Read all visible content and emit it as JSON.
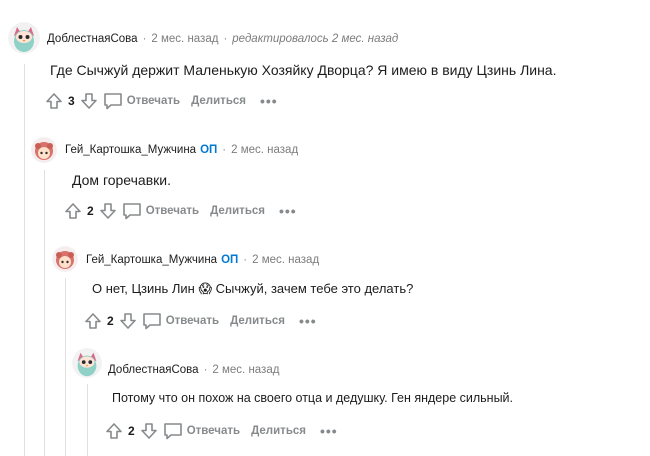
{
  "colors": {
    "accent_op": "#0079d3",
    "muted": "#878a8c",
    "thread_line": "#e0e0e0"
  },
  "comments": [
    {
      "author": "ДоблестнаяСова",
      "time": "2 мес. назад",
      "edited": "редактировалось 2 мес. назад",
      "text": "Где Сычжуй держит Маленькую Хозяйку Дворца? Я имею в виду Цзинь Лина.",
      "score": "3",
      "reply_label": "Отвечать",
      "share_label": "Делиться",
      "avatar_icon": "owl-avatar-icon"
    },
    {
      "author": "Гей_Картошка_Мужчина",
      "op_badge": "ОП",
      "time": "2 мес. назад",
      "text": "Дом горечавки.",
      "score": "2",
      "reply_label": "Отвечать",
      "share_label": "Делиться",
      "avatar_icon": "red-hair-avatar-icon"
    },
    {
      "author": "Гей_Картошка_Мужчина",
      "op_badge": "ОП",
      "time": "2 мес. назад",
      "text_before": "О нет, Цзинь Лин",
      "emoji": "😱",
      "text_after": "Сычжуй, зачем тебе это делать?",
      "score": "2",
      "reply_label": "Отвечать",
      "share_label": "Делиться",
      "avatar_icon": "red-hair-avatar-icon"
    },
    {
      "author": "ДоблестнаяСова",
      "time": "2 мес. назад",
      "text": "Потому что он похож на своего отца и дедушку. Ген яндере сильный.",
      "score": "2",
      "reply_label": "Отвечать",
      "share_label": "Делиться",
      "avatar_icon": "owl-avatar-icon"
    }
  ]
}
